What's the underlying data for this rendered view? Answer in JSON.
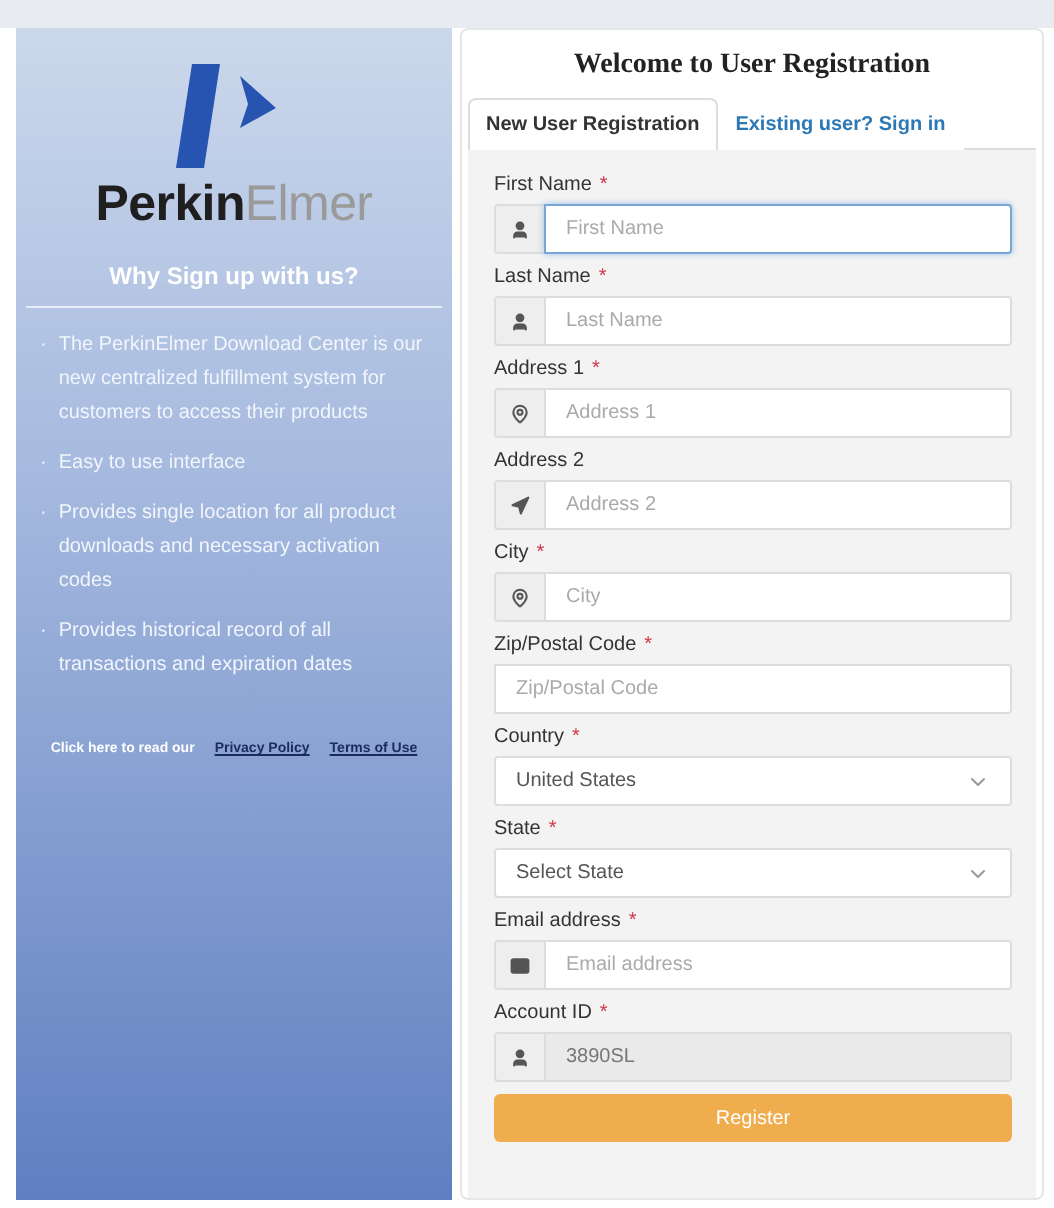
{
  "sidebar": {
    "logo_text": "**Perkin**Elmer",
    "heading": "Why Sign up with us?",
    "bullet": "·",
    "points": [
      "The PerkinElmer Download Center is our new centralized fulfillment system for customers to access their products",
      "Easy to use interface",
      "Provides single location for all product downloads and necessary activation codes",
      "Provides historical record of all transactions and expiration dates"
    ],
    "footer": {
      "text": "Click here to read our",
      "links": [
        "Privacy Policy",
        "Terms of Use"
      ]
    }
  },
  "form": {
    "title": "Welcome to User Registration",
    "tabs": [
      {
        "label": "New User Registration",
        "selected": true
      },
      {
        "label": "Existing user? Sign in",
        "selected": false
      }
    ],
    "required_mark": "*",
    "fields": [
      {
        "kind": "user",
        "label": "First Name",
        "required": true,
        "placeholder": "First Name",
        "focused": true,
        "disabled": false
      },
      {
        "kind": "user",
        "label": "Last Name",
        "required": true,
        "placeholder": "Last Name",
        "focused": false,
        "disabled": false
      },
      {
        "kind": "location",
        "label": "Address 1",
        "required": true,
        "placeholder": "Address 1",
        "focused": false,
        "disabled": false
      },
      {
        "kind": "direction",
        "label": "Address 2",
        "required": false,
        "placeholder": "Address 2",
        "focused": false,
        "disabled": false
      },
      {
        "kind": "location",
        "label": "City",
        "required": true,
        "placeholder": "City",
        "focused": false,
        "disabled": false
      },
      {
        "kind": "plain",
        "label": "Zip/Postal Code",
        "required": true,
        "placeholder": "Zip/Postal Code",
        "focused": false,
        "disabled": false
      },
      {
        "kind": "select",
        "label": "Country",
        "required": true,
        "value": "United States"
      },
      {
        "kind": "select",
        "label": "State",
        "required": true,
        "value": "Select State"
      },
      {
        "kind": "email",
        "label": "Email address",
        "required": true,
        "placeholder": "Email address",
        "focused": false,
        "disabled": false
      },
      {
        "kind": "user",
        "label": "Account ID",
        "required": true,
        "value": "3890SL",
        "focused": false,
        "disabled": true
      }
    ],
    "submit": "Register"
  }
}
